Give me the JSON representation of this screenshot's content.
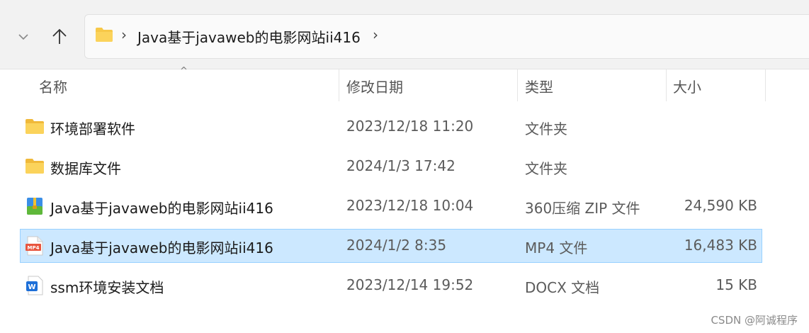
{
  "address_bar": {
    "chevron": "›",
    "path": "Java基于javaweb的电影网站ii416",
    "trailing_chevron": "›"
  },
  "columns": {
    "name": "名称",
    "date": "修改日期",
    "type": "类型",
    "size": "大小",
    "sort_indicator": "^"
  },
  "files": [
    {
      "name": "环境部署软件",
      "date": "2023/12/18 11:20",
      "type": "文件夹",
      "size": "",
      "icon": "folder-icon"
    },
    {
      "name": "数据库文件",
      "date": "2024/1/3 17:42",
      "type": "文件夹",
      "size": "",
      "icon": "folder-icon"
    },
    {
      "name": "Java基于javaweb的电影网站ii416",
      "date": "2023/12/18 10:04",
      "type": "360压缩 ZIP 文件",
      "size": "24,590 KB",
      "icon": "zip-archive-icon"
    },
    {
      "name": "Java基于javaweb的电影网站ii416",
      "date": "2024/1/2 8:35",
      "type": "MP4 文件",
      "size": "16,483 KB",
      "icon": "mp4-file-icon",
      "selected": true
    },
    {
      "name": "ssm环境安装文档",
      "date": "2023/12/14 19:52",
      "type": "DOCX 文档",
      "size": "15 KB",
      "icon": "word-doc-icon"
    }
  ],
  "watermark": "CSDN @阿诚程序",
  "colors": {
    "selection": "#cce8ff",
    "selection_border": "#99d1ff",
    "folder": "#f7c848",
    "mp4_icon": "#e8553e",
    "word_icon": "#1d6fd8"
  }
}
